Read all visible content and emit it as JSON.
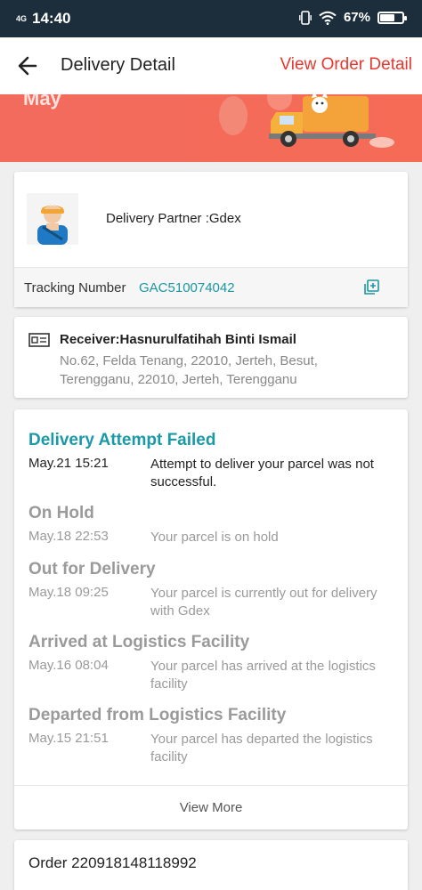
{
  "status_bar": {
    "network": "4G",
    "time": "14:40",
    "battery_pct": "67%",
    "battery_level": 0.67
  },
  "header": {
    "title": "Delivery Detail",
    "view_order": "View Order Detail"
  },
  "banner": {
    "text": "May"
  },
  "partner": {
    "label": "Delivery Partner :Gdex",
    "tracking_label": "Tracking Number",
    "tracking_number": "GAC510074042"
  },
  "receiver": {
    "name": "Receiver:Hasnurulfatihah Binti Ismail",
    "address": "No.62, Felda Tenang, 22010, Jerteh, Besut, Terengganu, 22010, Jerteh, Terengganu"
  },
  "timeline": [
    {
      "status": "Delivery Attempt Failed",
      "time": "May.21 15:21",
      "desc": "Attempt to deliver your parcel was not successful."
    },
    {
      "status": "On Hold",
      "time": "May.18 22:53",
      "desc": "Your parcel is on hold"
    },
    {
      "status": "Out for Delivery",
      "time": "May.18 09:25",
      "desc": "Your parcel is currently out for delivery with Gdex"
    },
    {
      "status": "Arrived at Logistics Facility",
      "time": "May.16 08:04",
      "desc": "Your parcel has arrived at the logistics facility"
    },
    {
      "status": "Departed from Logistics Facility",
      "time": "May.15 21:51",
      "desc": "Your parcel has departed the logistics facility"
    }
  ],
  "view_more": "View More",
  "order": {
    "label": "Order 220918148118992"
  },
  "colors": {
    "accent": "#e8372d",
    "teal": "#1a9aa6",
    "banner": "#f26b5d",
    "statusbar": "#1c2e3b"
  }
}
